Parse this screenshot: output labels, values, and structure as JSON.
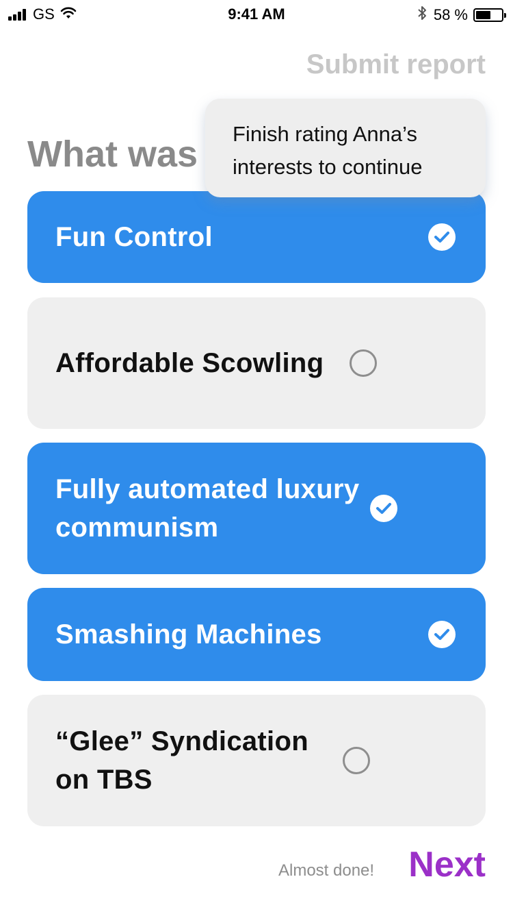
{
  "status_bar": {
    "carrier": "GS",
    "time": "9:41 AM",
    "battery_text": "58 %",
    "battery_level": 0.58,
    "icons": [
      "signal-icon",
      "wifi-icon",
      "bluetooth-icon",
      "battery-icon"
    ]
  },
  "header": {
    "submit_label": "Submit report",
    "title_partial": "What was"
  },
  "tooltip": {
    "text": "Finish rating Anna’s interests to continue"
  },
  "options": [
    {
      "label": "Fun Control",
      "selected": true
    },
    {
      "label": "Affordable Scowling",
      "selected": false
    },
    {
      "label": "Fully automated luxury communism",
      "selected": true
    },
    {
      "label": "Smashing Machines",
      "selected": true
    },
    {
      "label": "“Glee” Syndication on TBS",
      "selected": false
    }
  ],
  "footer": {
    "progress_text": "Almost done!",
    "next_label": "Next"
  },
  "colors": {
    "selected_bg": "#2f8ceb",
    "unselected_bg": "#efefef",
    "next_accent": "#9b30c8",
    "muted_text": "#c7c7c7"
  }
}
